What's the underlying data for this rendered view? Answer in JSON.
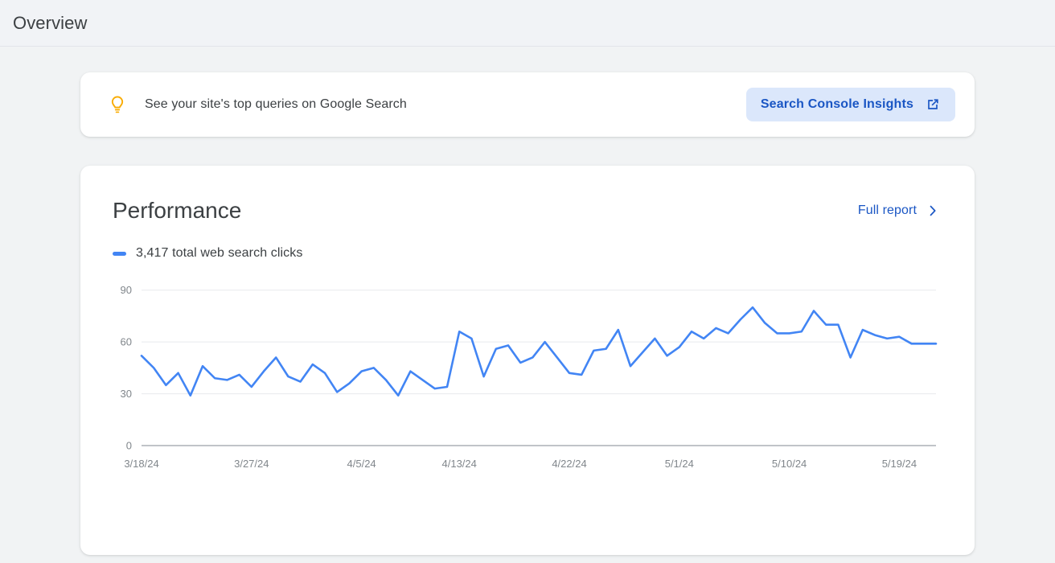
{
  "header": {
    "title": "Overview"
  },
  "insight_banner": {
    "icon": "lightbulb-icon",
    "message": "See your site's top queries on Google Search",
    "button_label": "Search Console Insights",
    "button_icon": "open-in-new-icon",
    "button_bg": "#dbe7fb",
    "button_color": "#1a56c4",
    "icon_color": "#f9ab00"
  },
  "performance_card": {
    "title": "Performance",
    "full_report_label": "Full report",
    "full_report_icon": "chevron-right-icon",
    "legend_label": "3,417 total web search clicks",
    "legend_color": "#4285f4",
    "total_clicks": "3,417"
  },
  "chart_data": {
    "type": "line",
    "title": "Performance",
    "series_name": "total web search clicks",
    "color": "#4285f4",
    "xlabel": "",
    "ylabel": "",
    "ylim": [
      0,
      95
    ],
    "yticks": [
      0,
      30,
      60,
      90
    ],
    "ytick_labels": [
      "0",
      "30",
      "60",
      "90"
    ],
    "grid": true,
    "legend_position": "top-left",
    "xtick_labels": [
      "3/18/24",
      "3/27/24",
      "4/5/24",
      "4/13/24",
      "4/22/24",
      "5/1/24",
      "5/10/24",
      "5/19/24"
    ],
    "xtick_indices": [
      0,
      9,
      18,
      26,
      35,
      44,
      53,
      62
    ],
    "x": [
      "3/18/24",
      "3/19/24",
      "3/20/24",
      "3/21/24",
      "3/22/24",
      "3/23/24",
      "3/24/24",
      "3/25/24",
      "3/26/24",
      "3/27/24",
      "3/28/24",
      "3/29/24",
      "3/30/24",
      "3/31/24",
      "4/1/24",
      "4/2/24",
      "4/3/24",
      "4/4/24",
      "4/5/24",
      "4/6/24",
      "4/7/24",
      "4/8/24",
      "4/9/24",
      "4/10/24",
      "4/11/24",
      "4/12/24",
      "4/13/24",
      "4/14/24",
      "4/15/24",
      "4/16/24",
      "4/17/24",
      "4/18/24",
      "4/19/24",
      "4/20/24",
      "4/21/24",
      "4/22/24",
      "4/23/24",
      "4/24/24",
      "4/25/24",
      "4/26/24",
      "4/27/24",
      "4/28/24",
      "4/29/24",
      "4/30/24",
      "5/1/24",
      "5/2/24",
      "5/3/24",
      "5/4/24",
      "5/5/24",
      "5/6/24",
      "5/7/24",
      "5/8/24",
      "5/9/24",
      "5/10/24",
      "5/11/24",
      "5/12/24",
      "5/13/24",
      "5/14/24",
      "5/15/24",
      "5/16/24",
      "5/17/24",
      "5/18/24",
      "5/19/24",
      "5/20/24",
      "5/21/24",
      "5/22/24"
    ],
    "values": [
      52,
      45,
      35,
      42,
      29,
      46,
      39,
      38,
      41,
      34,
      43,
      51,
      40,
      37,
      47,
      42,
      31,
      36,
      43,
      45,
      38,
      29,
      43,
      38,
      33,
      34,
      66,
      62,
      40,
      56,
      58,
      48,
      51,
      60,
      51,
      42,
      41,
      55,
      56,
      67,
      46,
      54,
      62,
      52,
      57,
      66,
      62,
      68,
      65,
      73,
      80,
      71,
      65,
      65,
      66,
      78,
      70,
      70,
      51,
      67,
      64,
      62,
      63,
      59,
      59,
      59
    ]
  }
}
